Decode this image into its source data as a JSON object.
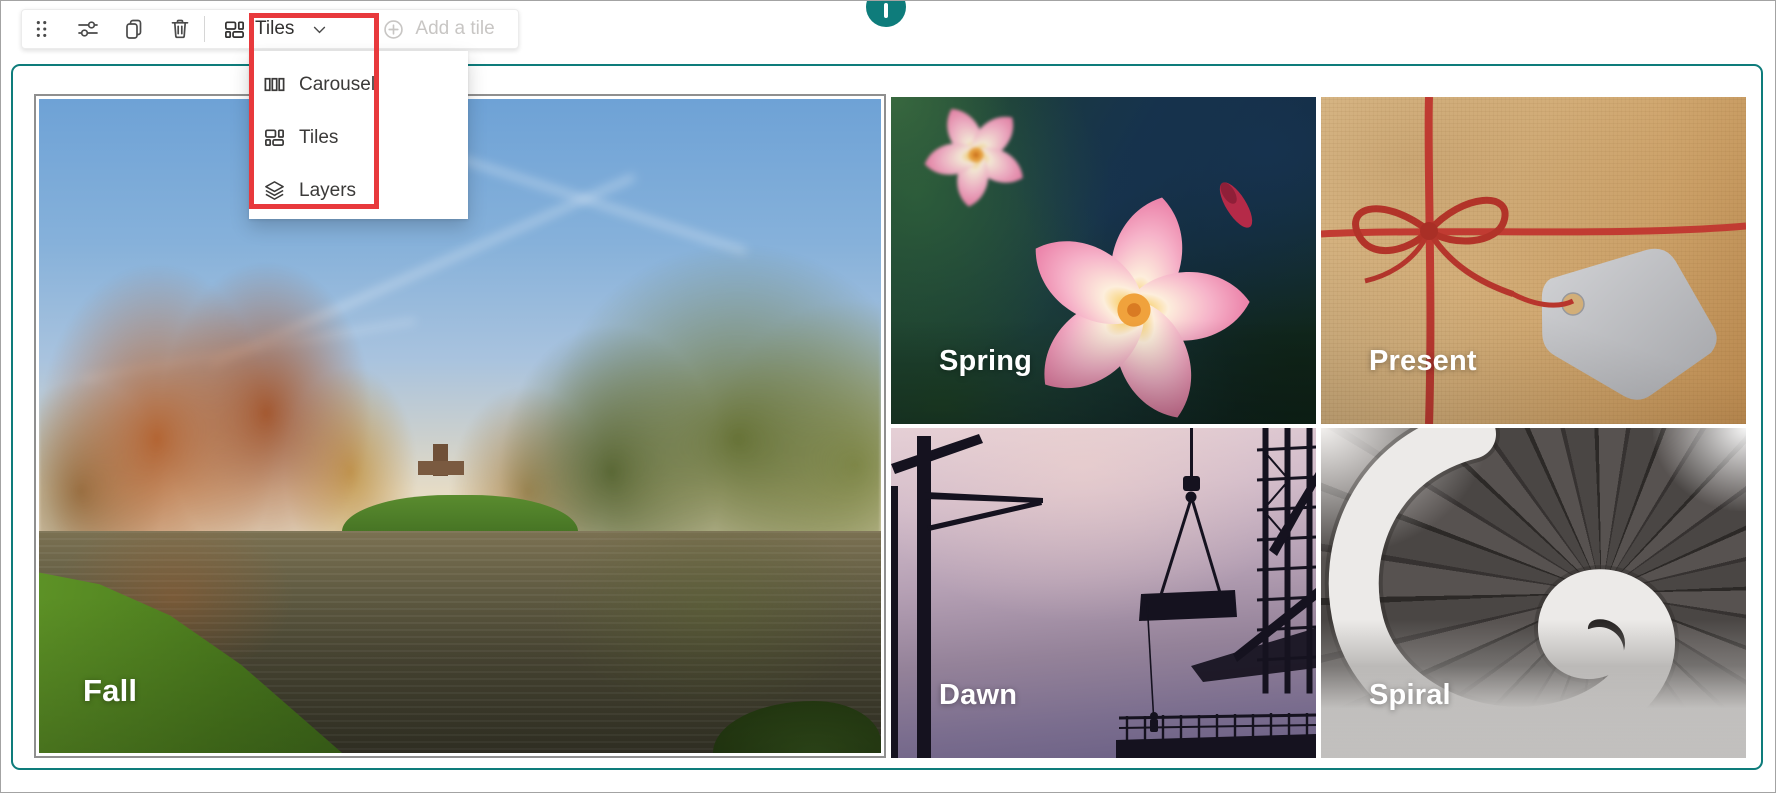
{
  "toolbar": {
    "tiles_dropdown_label": "Tiles",
    "add_tile_label": "Add a tile",
    "icons": [
      "drag-handle-icon",
      "tune-sliders-icon",
      "duplicate-icon",
      "delete-icon",
      "chevron-down-icon",
      "add-circle-icon"
    ]
  },
  "layout_menu": {
    "items": [
      {
        "label": "Carousel",
        "icon": "carousel-icon"
      },
      {
        "label": "Tiles",
        "icon": "tiles-icon"
      },
      {
        "label": "Layers",
        "icon": "layers-icon"
      }
    ]
  },
  "gallery": {
    "tiles": [
      {
        "title": "Fall",
        "size": "large",
        "selected": true
      },
      {
        "title": "Spring"
      },
      {
        "title": "Present"
      },
      {
        "title": "Dawn"
      },
      {
        "title": "Spiral"
      }
    ]
  },
  "colors": {
    "accent_teal": "#0e7c7b",
    "annotation_red": "#e8393c",
    "toolbar_icon_gray": "#4a4a4a",
    "disabled_text": "#c8c6c4",
    "menu_text": "#3b3a39",
    "tile_label_text": "#ffffff"
  }
}
